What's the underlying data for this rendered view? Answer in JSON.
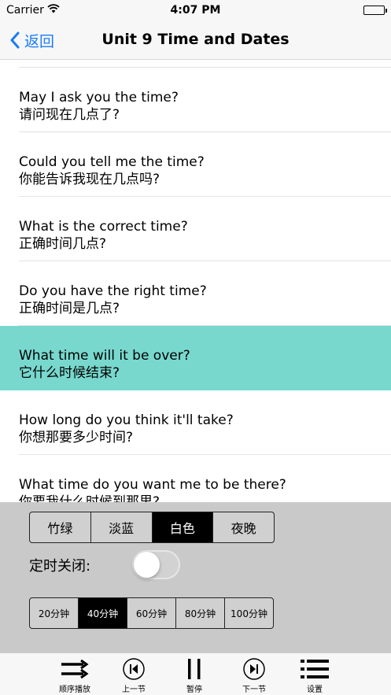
{
  "status_bar": {
    "carrier": "Carrier",
    "time": "4:07 PM"
  },
  "nav": {
    "back_label": "返回",
    "title": "Unit 9 Time and Dates"
  },
  "sentences": [
    {
      "en": "May I ask you the time?",
      "zh": "请问现在几点了?"
    },
    {
      "en": "Could you tell me the time?",
      "zh": "你能告诉我现在几点吗?"
    },
    {
      "en": "What is the correct time?",
      "zh": "正确时间几点?"
    },
    {
      "en": "Do you have the right time?",
      "zh": "正确时间是几点?"
    },
    {
      "en": "What time will it be over?",
      "zh": "它什么时候结束?"
    },
    {
      "en": "How long do you think it'll take?",
      "zh": "你想那要多少时间?"
    },
    {
      "en": "What time do you want me to be there?",
      "zh": "你要我什么时候到那里?"
    }
  ],
  "active_sentence_index": 4,
  "colors": {
    "highlight": "#78d8ce",
    "accent": "#1a7cf5",
    "panel": "#c9c9c9"
  },
  "settings": {
    "themes": [
      "竹绿",
      "淡蓝",
      "白色",
      "夜晚"
    ],
    "selected_theme": "白色",
    "timer_label": "定时关闭:",
    "timer_on": false,
    "durations": [
      "20分钟",
      "40分钟",
      "60分钟",
      "80分钟",
      "100分钟"
    ],
    "selected_duration": "40分钟"
  },
  "tabs": [
    {
      "label": "顺序播放",
      "icon": "sequence-play-icon"
    },
    {
      "label": "上一节",
      "icon": "previous-icon"
    },
    {
      "label": "暂停",
      "icon": "pause-icon"
    },
    {
      "label": "下一节",
      "icon": "next-icon"
    },
    {
      "label": "设置",
      "icon": "settings-list-icon"
    }
  ]
}
